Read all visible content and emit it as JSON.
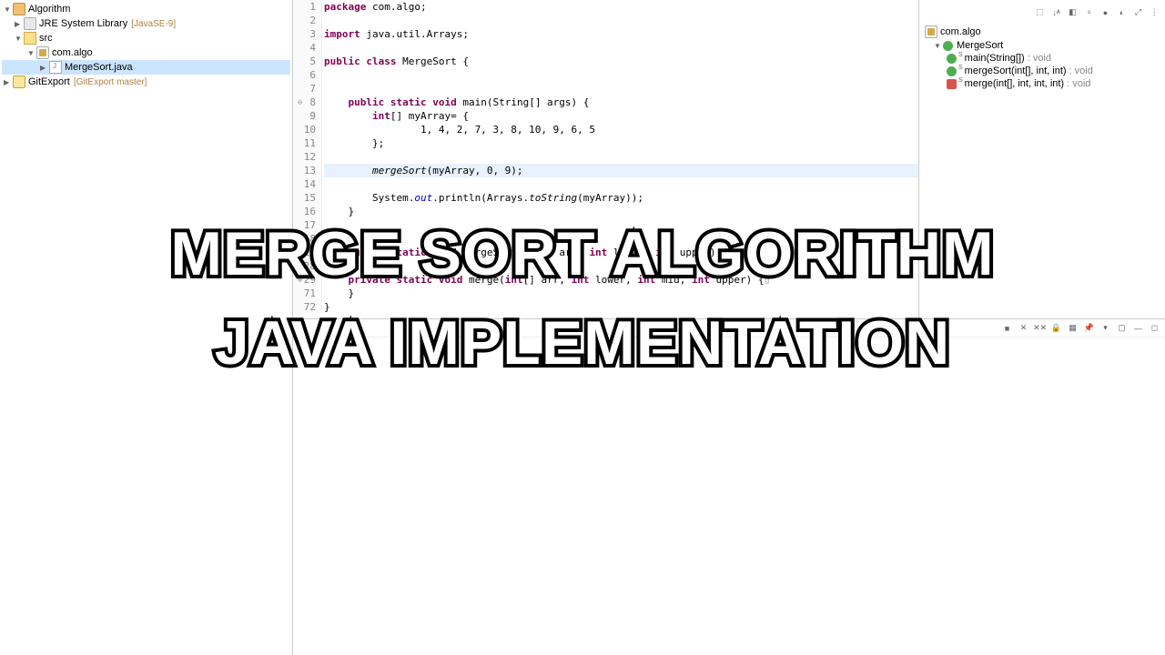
{
  "packageExplorer": {
    "root": "Algorithm",
    "jre": "JRE System Library",
    "jreDecor": "[JavaSE-9]",
    "src": "src",
    "pkg": "com.algo",
    "file": "MergeSort.java",
    "gitExport": "GitExport",
    "gitDecor": "[GitExport master]"
  },
  "code": {
    "lines": [
      {
        "n": "1",
        "tokens": [
          {
            "t": "package ",
            "c": "kw"
          },
          {
            "t": "com.algo;",
            "c": ""
          }
        ]
      },
      {
        "n": "2",
        "tokens": []
      },
      {
        "n": "3",
        "tokens": [
          {
            "t": "import ",
            "c": "kw"
          },
          {
            "t": "java.util.Arrays;",
            "c": ""
          }
        ]
      },
      {
        "n": "4",
        "tokens": []
      },
      {
        "n": "5",
        "tokens": [
          {
            "t": "public class ",
            "c": "kw"
          },
          {
            "t": "MergeSort {",
            "c": ""
          }
        ]
      },
      {
        "n": "6",
        "tokens": []
      },
      {
        "n": "7",
        "tokens": []
      },
      {
        "n": "8",
        "fold": "⊖",
        "tokens": [
          {
            "t": "    ",
            "c": ""
          },
          {
            "t": "public static void ",
            "c": "kw"
          },
          {
            "t": "main(String[] args) {",
            "c": ""
          }
        ]
      },
      {
        "n": "9",
        "tokens": [
          {
            "t": "        ",
            "c": ""
          },
          {
            "t": "int",
            "c": "kw"
          },
          {
            "t": "[] myArray= {",
            "c": ""
          }
        ]
      },
      {
        "n": "10",
        "tokens": [
          {
            "t": "                1, 4, 2, 7, 3, 8, 10, 9, 6, 5",
            "c": ""
          }
        ]
      },
      {
        "n": "11",
        "tokens": [
          {
            "t": "        };",
            "c": ""
          }
        ]
      },
      {
        "n": "12",
        "tokens": []
      },
      {
        "n": "13",
        "hl": true,
        "tokens": [
          {
            "t": "        ",
            "c": ""
          },
          {
            "t": "mergeSort",
            "c": "fn"
          },
          {
            "t": "(myArray, 0, 9);",
            "c": ""
          }
        ]
      },
      {
        "n": "14",
        "tokens": []
      },
      {
        "n": "15",
        "tokens": [
          {
            "t": "        System.",
            "c": ""
          },
          {
            "t": "out",
            "c": "static-field"
          },
          {
            "t": ".println(Arrays.",
            "c": ""
          },
          {
            "t": "toString",
            "c": "fn"
          },
          {
            "t": "(myArray));",
            "c": ""
          }
        ]
      },
      {
        "n": "16",
        "tokens": [
          {
            "t": "    }",
            "c": ""
          }
        ]
      },
      {
        "n": "17",
        "tokens": []
      },
      {
        "n": "18",
        "tokens": []
      },
      {
        "n": "19",
        "fold": "⊕",
        "tokens": [
          {
            "t": "    ",
            "c": ""
          },
          {
            "t": "public static void ",
            "c": "kw"
          },
          {
            "t": "mergeSort(",
            "c": ""
          },
          {
            "t": "int",
            "c": "kw"
          },
          {
            "t": "[] arr, ",
            "c": ""
          },
          {
            "t": "int",
            "c": "kw"
          },
          {
            "t": " lower, ",
            "c": ""
          },
          {
            "t": "int",
            "c": "kw"
          },
          {
            "t": " upper) {",
            "c": ""
          },
          {
            "t": "▯",
            "c": "collapsed"
          }
        ]
      },
      {
        "n": "28",
        "tokens": []
      },
      {
        "n": "29",
        "fold": "⊕",
        "tokens": [
          {
            "t": "    ",
            "c": ""
          },
          {
            "t": "private static void ",
            "c": "kw"
          },
          {
            "t": "merge(",
            "c": ""
          },
          {
            "t": "int",
            "c": "kw"
          },
          {
            "t": "[] arr, ",
            "c": ""
          },
          {
            "t": "int",
            "c": "kw"
          },
          {
            "t": " lower, ",
            "c": ""
          },
          {
            "t": "int",
            "c": "kw"
          },
          {
            "t": " mid, ",
            "c": ""
          },
          {
            "t": "int",
            "c": "kw"
          },
          {
            "t": " upper) {",
            "c": ""
          },
          {
            "t": "▯",
            "c": "collapsed"
          }
        ]
      },
      {
        "n": "71",
        "tokens": [
          {
            "t": "    }",
            "c": ""
          }
        ]
      },
      {
        "n": "72",
        "tokens": [
          {
            "t": "}",
            "c": ""
          }
        ]
      }
    ]
  },
  "outline": {
    "pkg": "com.algo",
    "class": "MergeSort",
    "methods": [
      {
        "vis": "public",
        "name": "main(String[])",
        "ret": ": void"
      },
      {
        "vis": "public",
        "name": "mergeSort(int[], int, int)",
        "ret": ": void"
      },
      {
        "vis": "private",
        "name": "merge(int[], int, int, int)",
        "ret": ": void"
      }
    ]
  },
  "overlay": {
    "line1": "MERGE SORT ALGORITHM",
    "line2": "JAVA IMPLEMENTATION"
  }
}
